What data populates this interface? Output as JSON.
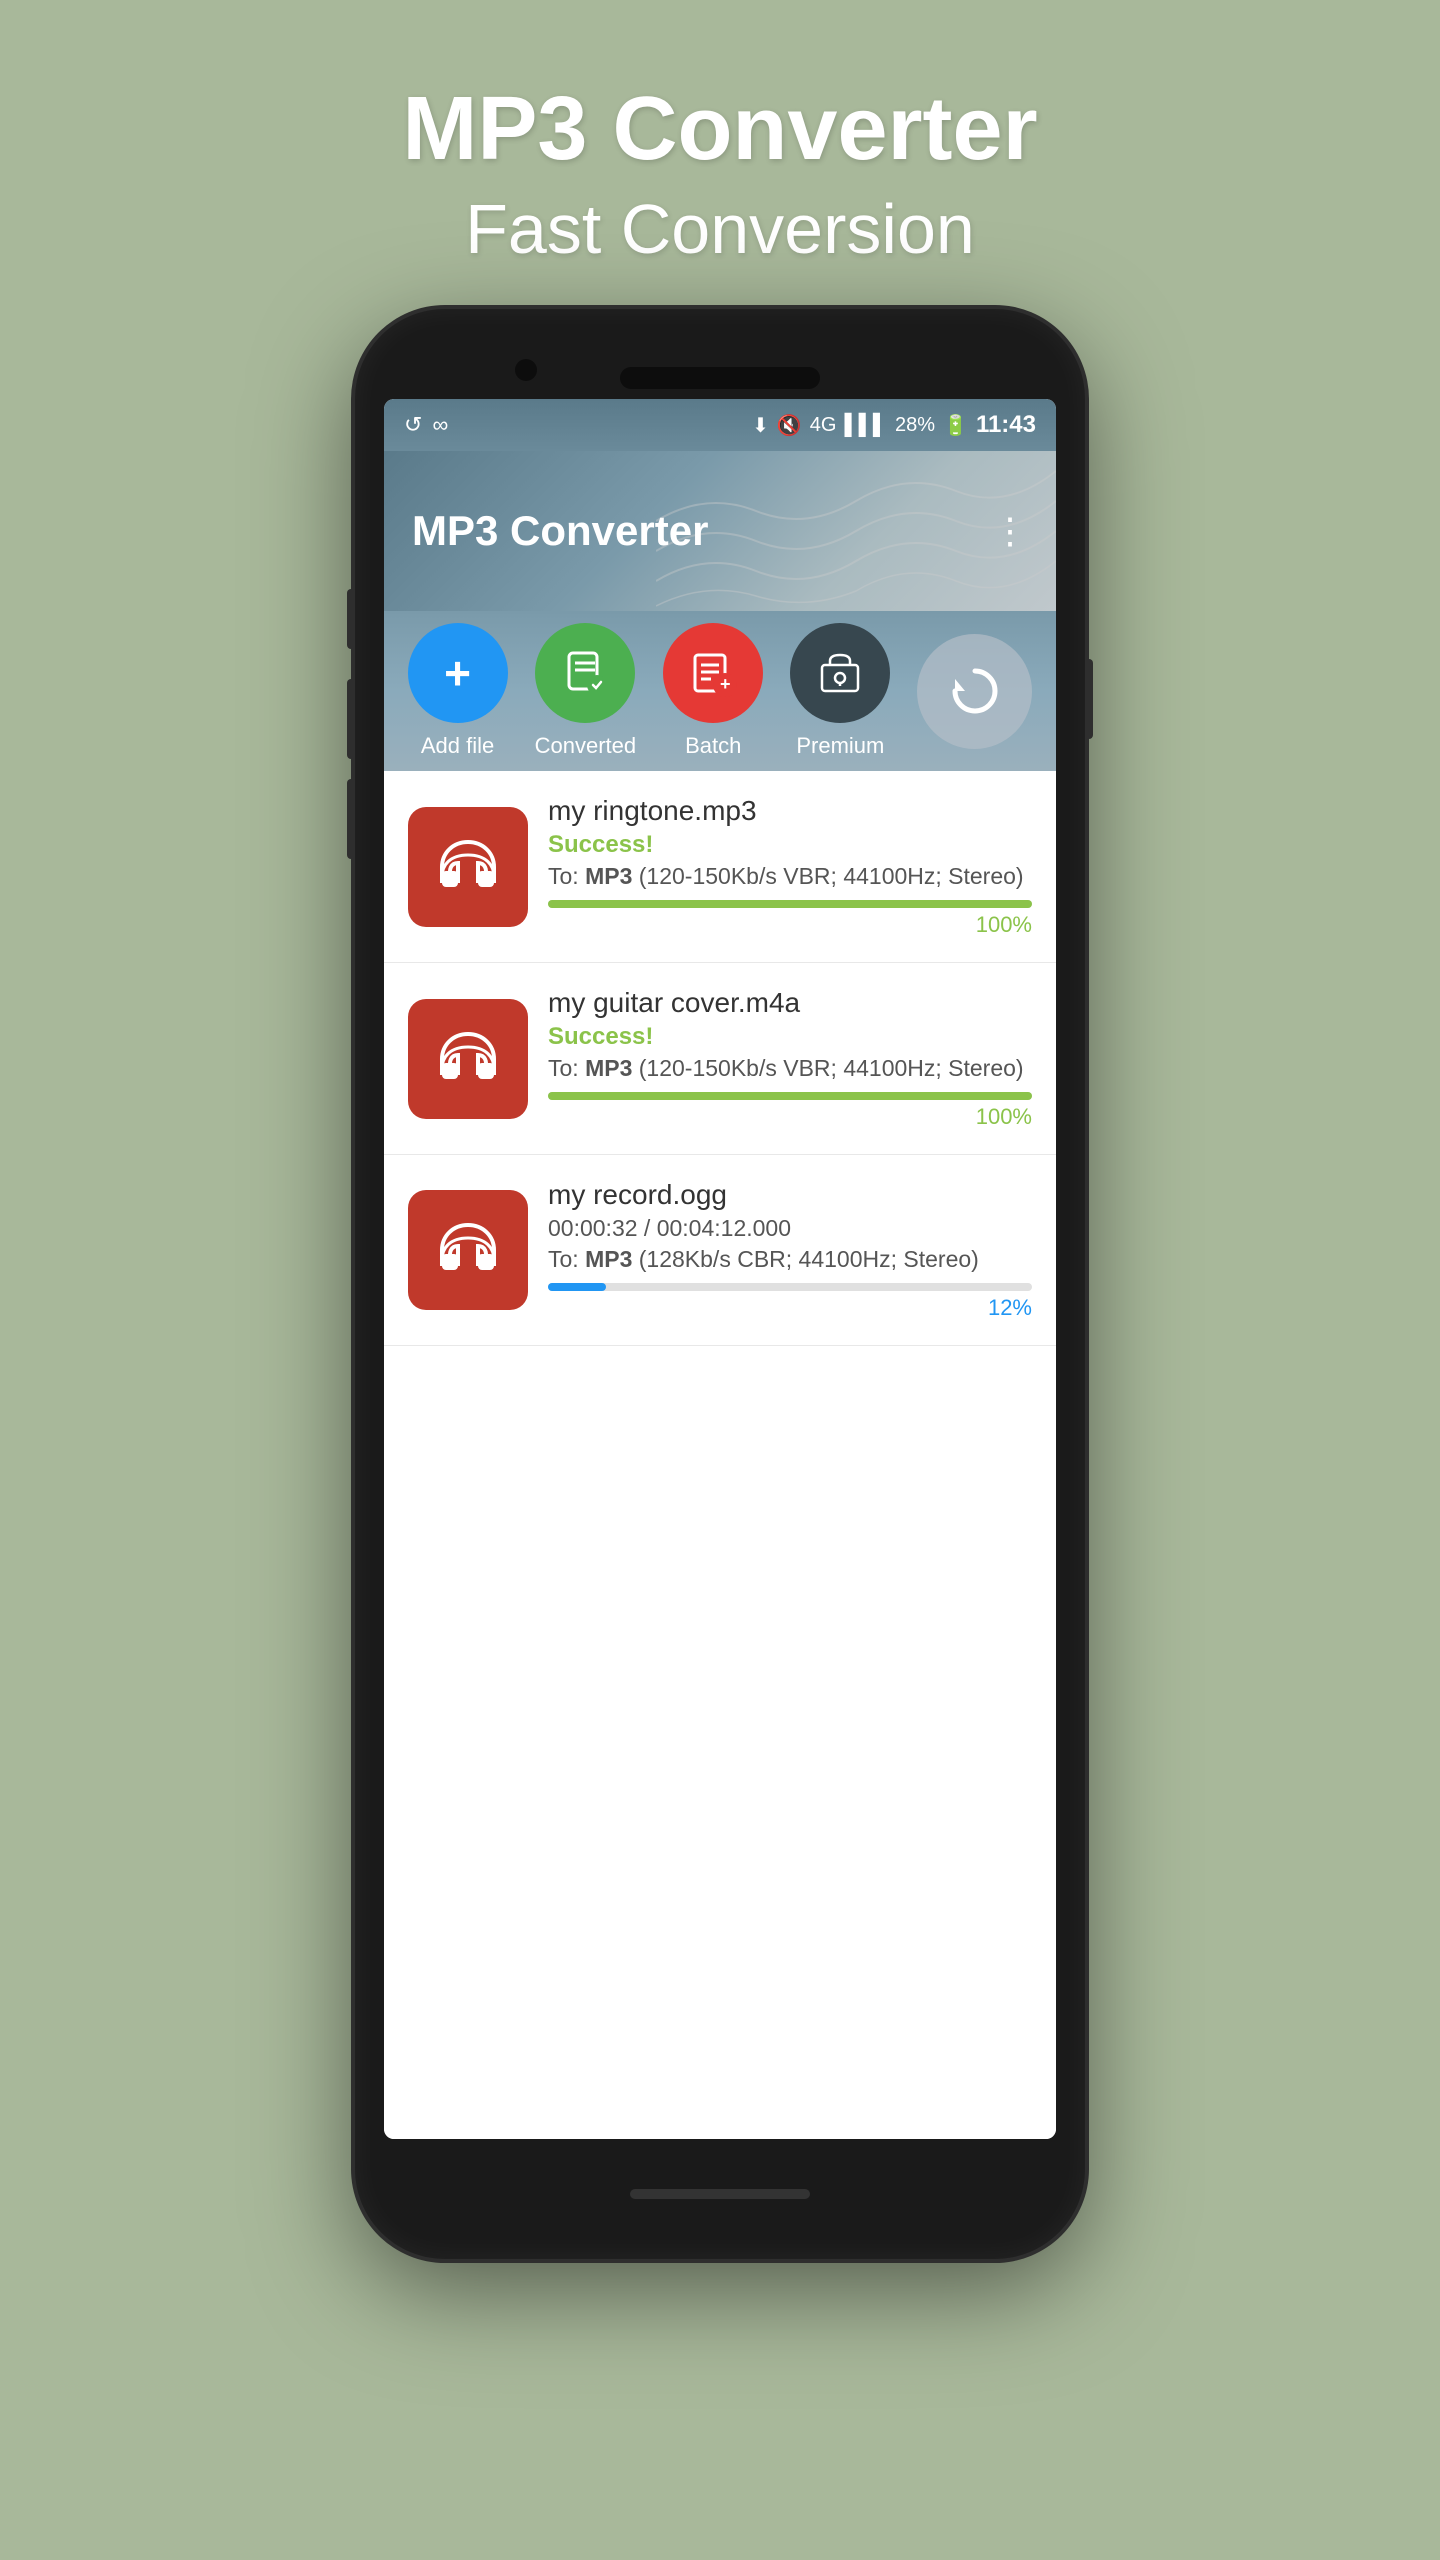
{
  "page": {
    "title": "MP3 Converter",
    "subtitle": "Fast Conversion",
    "background_color": "#a8b89a"
  },
  "status_bar": {
    "left_icons": [
      "↺",
      "∞"
    ],
    "battery_percent": "28%",
    "network": "4G",
    "time": "11:43",
    "signal": "▌▌▌"
  },
  "app_header": {
    "title": "MP3 Converter",
    "menu_icon": "⋮"
  },
  "action_buttons": [
    {
      "id": "add-file",
      "label": "Add file",
      "icon": "+",
      "color": "btn-blue"
    },
    {
      "id": "converted",
      "label": "Converted",
      "icon": "♪",
      "color": "btn-green"
    },
    {
      "id": "batch",
      "label": "Batch",
      "icon": "≡+",
      "color": "btn-red"
    },
    {
      "id": "premium",
      "label": "Premium",
      "icon": "🛒",
      "color": "btn-dark"
    }
  ],
  "refresh_button": {
    "label": "refresh",
    "icon": "↺"
  },
  "files": [
    {
      "id": "file-1",
      "name": "my ringtone.mp3",
      "status": "Success!",
      "format_line": "To: MP3 (120-150Kb/s VBR; 44100Hz; Stereo)",
      "format_bold": "MP3",
      "progress": 100,
      "progress_type": "green",
      "progress_label": "100%"
    },
    {
      "id": "file-2",
      "name": "my guitar cover.m4a",
      "status": "Success!",
      "format_line": "To: MP3 (120-150Kb/s VBR; 44100Hz; Stereo)",
      "format_bold": "MP3",
      "progress": 100,
      "progress_type": "green",
      "progress_label": "100%"
    },
    {
      "id": "file-3",
      "name": "my record.ogg",
      "status": null,
      "time_line": "00:00:32 / 00:04:12.000",
      "format_line": "To: MP3 (128Kb/s CBR; 44100Hz; Stereo)",
      "format_bold": "MP3",
      "progress": 12,
      "progress_type": "blue",
      "progress_label": "12%"
    }
  ]
}
